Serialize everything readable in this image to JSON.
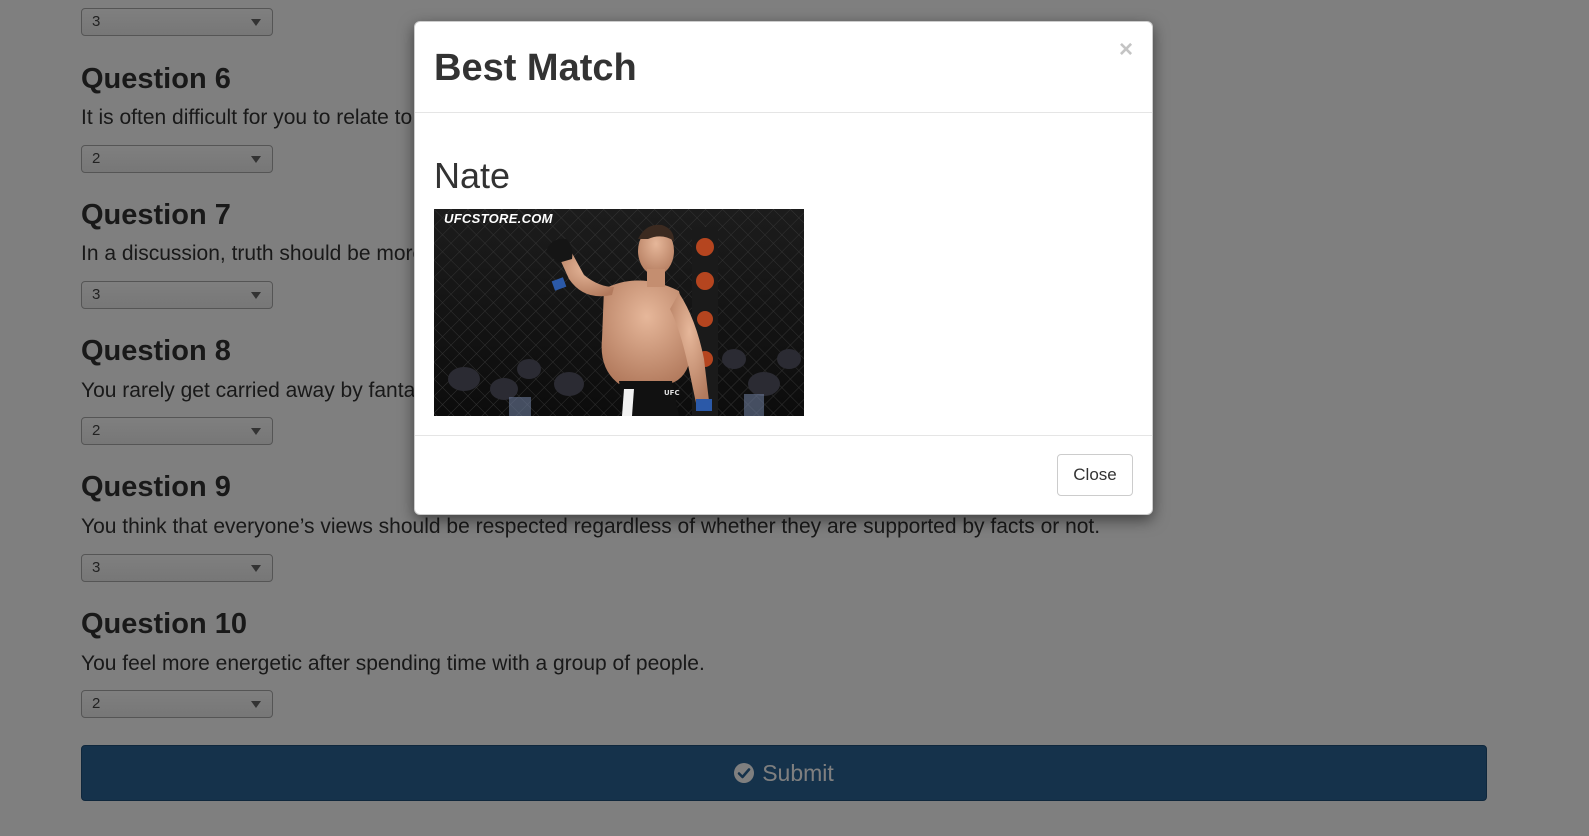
{
  "questions": [
    {
      "select_value": "3"
    },
    {
      "title": "Question 6",
      "text": "It is often difficult for you to relate to other people’s feelings.",
      "select_value": "2"
    },
    {
      "title": "Question 7",
      "text": "In a discussion, truth should be more important than people’s sensitivities.",
      "select_value": "3"
    },
    {
      "title": "Question 8",
      "text": "You rarely get carried away by fantasies and ideas.",
      "select_value": "2"
    },
    {
      "title": "Question 9",
      "text": "You think that everyone’s views should be respected regardless of whether they are supported by facts or not.",
      "select_value": "3"
    },
    {
      "title": "Question 10",
      "text": "You feel more energetic after spending time with a group of people.",
      "select_value": "2"
    }
  ],
  "submit": {
    "label": "Submit",
    "icon": "check-circle-icon"
  },
  "modal": {
    "title": "Best Match",
    "close_x": "×",
    "match_name": "Nate",
    "photo_watermark": "UFCSTORE.COM",
    "close_button": "Close"
  },
  "colors": {
    "submit_bg": "#2a6496",
    "backdrop": "rgba(0,0,0,0.5)"
  }
}
